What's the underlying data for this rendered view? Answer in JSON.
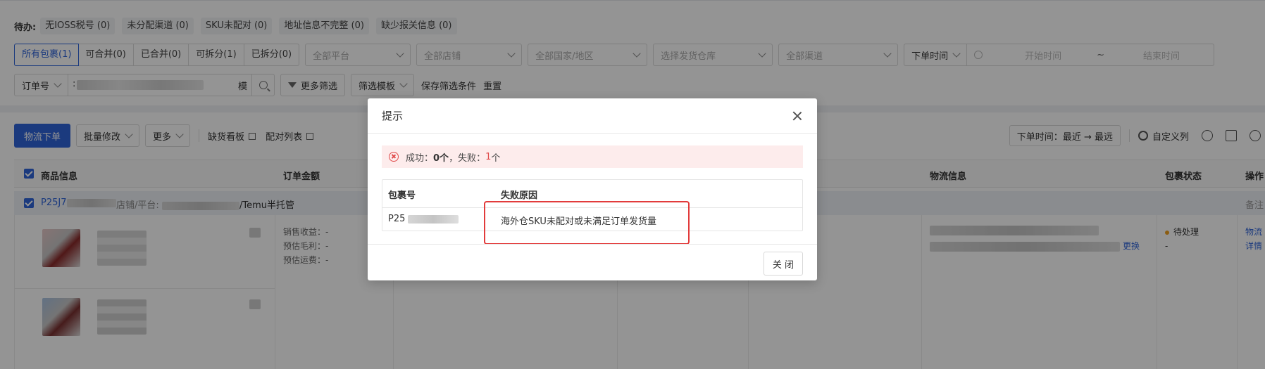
{
  "filters": {
    "pending_label": "待办:",
    "chips": [
      "无IOSS税号 (0)",
      "未分配渠道 (0)",
      "SKU未配对 (0)",
      "地址信息不完整 (0)",
      "缺少报关信息 (0)"
    ],
    "segments": [
      "所有包裹(1)",
      "可合并(0)",
      "已合并(0)",
      "可拆分(1)",
      "已拆分(0)"
    ],
    "selects": {
      "platform": "全部平台",
      "store": "全部店铺",
      "country": "全部国家/地区",
      "warehouse": "选择发货仓库",
      "channel": "全部渠道"
    },
    "date_type": "下单时间",
    "date_start": "开始时间",
    "date_sep": "~",
    "date_end": "结束时间",
    "search_type": "订单号",
    "search_prefix": ":",
    "search_mode": "模",
    "more_filters": "更多筛选",
    "filter_template": "筛选模板",
    "save_filter": "保存筛选条件",
    "reset": "重置"
  },
  "toolbar": {
    "logistics_order": "物流下单",
    "batch_edit": "批量修改",
    "more": "更多",
    "stock_board": "缺货看板",
    "pair_list": "配对列表",
    "sort_label": "下单时间：",
    "sort_value": "最近 → 最远",
    "custom_columns": "自定义列"
  },
  "table": {
    "headers": [
      "商品信息",
      "订单金额",
      "物流信息",
      "包裹状态",
      "操作"
    ],
    "group": {
      "package_prefix": "P25J7",
      "store_label": "店铺/平台:",
      "platform_suffix": "/Temu半托管",
      "note": "备注"
    },
    "row": {
      "sales_income": "销售收益：-",
      "est_margin": "预估毛利：-",
      "est_freight": "预估运费：-",
      "replace": "更换",
      "status": "待处理",
      "status_sub": "-",
      "action_logistics": "物流",
      "action_detail": "详情"
    }
  },
  "modal": {
    "title": "提示",
    "result_success_label": "成功：",
    "result_success_count": "0个",
    "result_sep": "，失败：",
    "result_fail_num": "1",
    "result_fail_unit": "个",
    "col_package": "包裹号",
    "col_reason": "失败原因",
    "package_prefix": "P25",
    "reason": "海外仓SKU未配对或未满足订单发货量",
    "close_button": "关 闭"
  },
  "colors": {
    "primary": "#2f64d9",
    "error": "#e04a4a",
    "highlight": "#e23b3b",
    "status_pending": "#f0a020"
  }
}
